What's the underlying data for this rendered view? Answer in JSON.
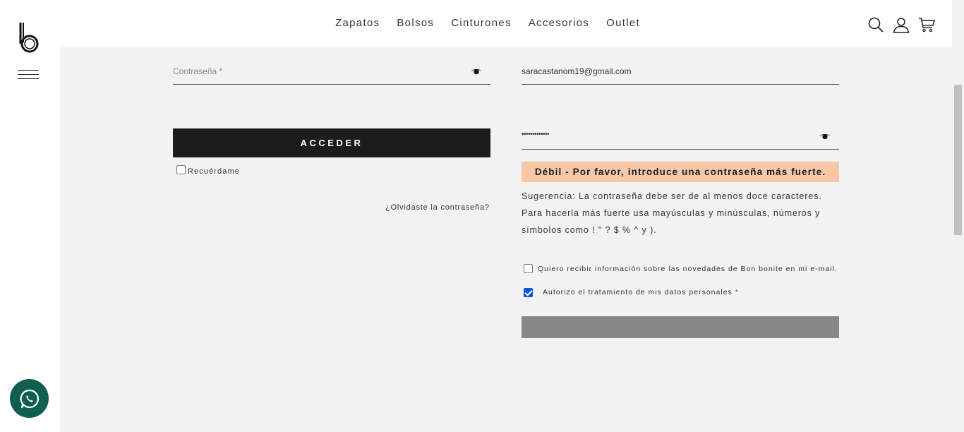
{
  "nav": {
    "items": [
      "Zapatos",
      "Bolsos",
      "Cinturones",
      "Accesorios",
      "Outlet"
    ]
  },
  "icons": {
    "logo": "logo-b",
    "menu": "hamburger-icon",
    "search": "search-icon",
    "account": "user-icon",
    "cart": "cart-icon",
    "whatsapp": "whatsapp-icon",
    "toggle_password": "eye-icon"
  },
  "login": {
    "password_placeholder": "Contraseña *",
    "submit_label": "ACCEDER",
    "remember_label": "Recuérdame",
    "forgot_link": "¿Olvidaste la contraseña?"
  },
  "register": {
    "email_value": "saracastanom19@gmail.com",
    "password_value": "•••••••••••••",
    "strength_message": "Débil - Por favor, introduce una contraseña más fuerte.",
    "hint_text": "Sugerencia: La contraseña debe ser de al menos doce caracteres. Para hacerla más fuerte usa mayúsculas y minúsculas, números y símbolos como ! \" ? $ % ^ y ).",
    "newsletter_label": "Quiero recibir información sobre las novedades de Bon bonite en mi e-mail.",
    "newsletter_checked": false,
    "privacy_label": "Autorizo el tratamiento de mis datos personales",
    "privacy_required_mark": "*",
    "privacy_checked": true
  },
  "colors": {
    "sidebar_bg": "#ffffff",
    "page_bg": "#f2f2f2",
    "button_dark": "#1c1c1c",
    "weak_bg": "#f8c7a8",
    "whatsapp_bg": "#0f5e4f",
    "register_button": "#888888",
    "checkbox_accent": "#0b57d0"
  }
}
